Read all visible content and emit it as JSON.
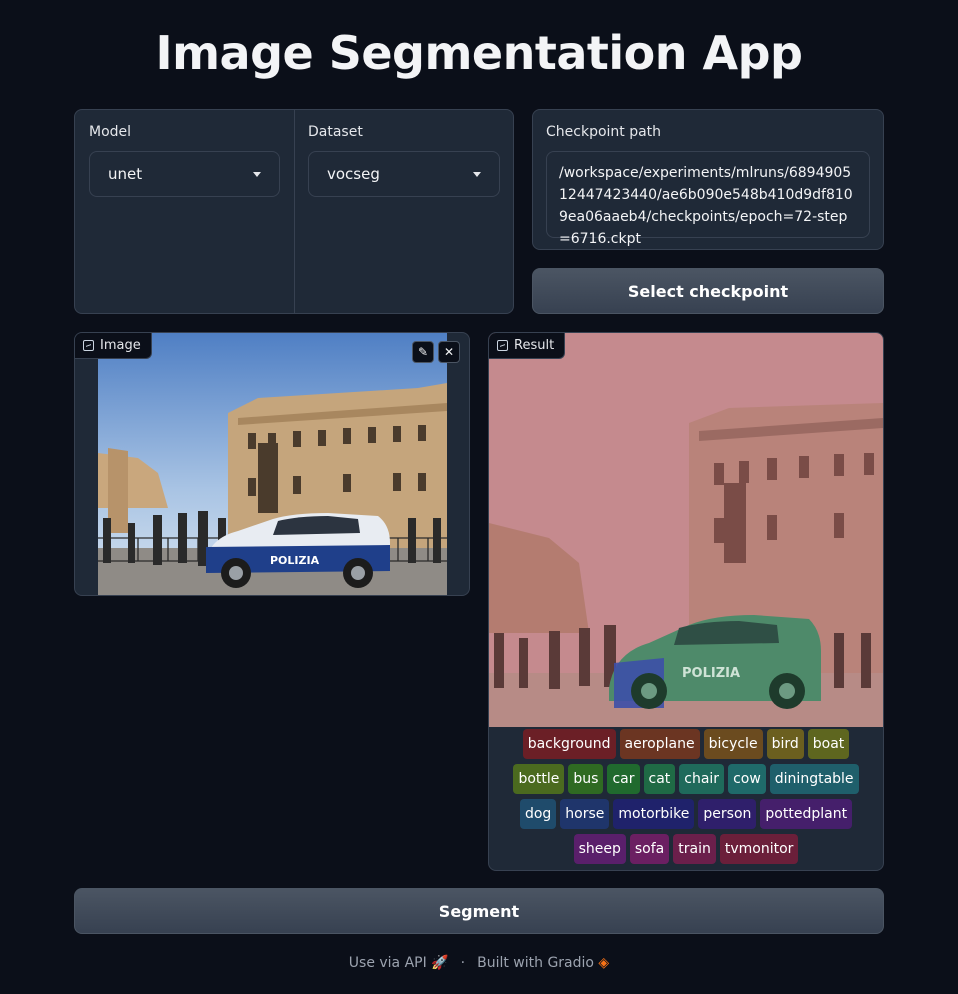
{
  "app": {
    "title": "Image Segmentation App"
  },
  "model": {
    "label": "Model",
    "value": "unet"
  },
  "dataset": {
    "label": "Dataset",
    "value": "vocseg"
  },
  "checkpoint": {
    "label": "Checkpoint path",
    "value": "/workspace/experiments/mlruns/689490512447423440/ae6b090e548b410d9df8109ea06aaeb4/checkpoints/epoch=72-step=6716.ckpt",
    "button": "Select checkpoint"
  },
  "image_panel": {
    "label": "Image",
    "edit_icon": "pencil-icon",
    "close_icon": "close-icon"
  },
  "result_panel": {
    "label": "Result",
    "classes": [
      {
        "name": "background",
        "color": "#6b1f26"
      },
      {
        "name": "aeroplane",
        "color": "#6b3522"
      },
      {
        "name": "bicycle",
        "color": "#6b4b1f"
      },
      {
        "name": "bird",
        "color": "#6b5f1f"
      },
      {
        "name": "boat",
        "color": "#5e661f"
      },
      {
        "name": "bottle",
        "color": "#4b6a1f"
      },
      {
        "name": "bus",
        "color": "#2f6a22"
      },
      {
        "name": "car",
        "color": "#206a2e"
      },
      {
        "name": "cat",
        "color": "#1f6a45"
      },
      {
        "name": "chair",
        "color": "#1f6a5b"
      },
      {
        "name": "cow",
        "color": "#1f6a6a"
      },
      {
        "name": "diningtable",
        "color": "#1f5f6b"
      },
      {
        "name": "dog",
        "color": "#1f4b6b"
      },
      {
        "name": "horse",
        "color": "#1f356b"
      },
      {
        "name": "motorbike",
        "color": "#1f226b"
      },
      {
        "name": "person",
        "color": "#2f1f6b"
      },
      {
        "name": "pottedplant",
        "color": "#451f6b"
      },
      {
        "name": "sheep",
        "color": "#5a1f6b"
      },
      {
        "name": "sofa",
        "color": "#6b1f62"
      },
      {
        "name": "train",
        "color": "#6b1f4b"
      },
      {
        "name": "tvmonitor",
        "color": "#6b1f3a"
      }
    ]
  },
  "segment": {
    "button": "Segment"
  },
  "footer": {
    "api": "Use via API",
    "separator": "·",
    "built": "Built with Gradio",
    "rocket_icon": "rocket-icon",
    "gradio_icon": "gradio-logo-icon"
  }
}
